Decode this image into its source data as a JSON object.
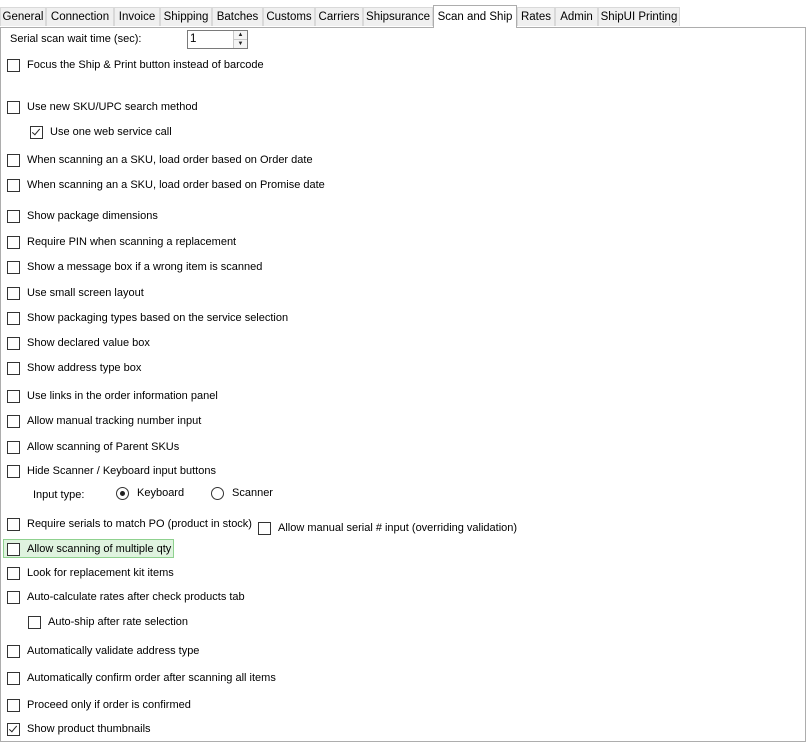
{
  "tabs": [
    {
      "label": "General"
    },
    {
      "label": "Connection"
    },
    {
      "label": "Invoice"
    },
    {
      "label": "Shipping"
    },
    {
      "label": "Batches"
    },
    {
      "label": "Customs"
    },
    {
      "label": "Carriers"
    },
    {
      "label": "Shipsurance"
    },
    {
      "label": "Scan and Ship",
      "active": true
    },
    {
      "label": "Rates"
    },
    {
      "label": "Admin"
    },
    {
      "label": "ShipUI Printing"
    }
  ],
  "serial_wait": {
    "label": "Serial scan wait time (sec):",
    "value": "1"
  },
  "options": {
    "focus_ship_print": {
      "label": "Focus the Ship & Print button instead of barcode",
      "checked": false
    },
    "new_sku_search": {
      "label": "Use new SKU/UPC search method",
      "checked": false
    },
    "one_web_service": {
      "label": "Use one web service call",
      "checked": true
    },
    "load_by_order_date": {
      "label": "When scanning an a SKU, load order based on Order date",
      "checked": false
    },
    "load_by_promise_date": {
      "label": "When scanning an a SKU, load order based on Promise date",
      "checked": false
    },
    "show_package_dimensions": {
      "label": "Show package dimensions",
      "checked": false
    },
    "require_pin": {
      "label": "Require PIN when scanning a replacement",
      "checked": false
    },
    "wrong_item_message": {
      "label": "Show a message box if a wrong item is scanned",
      "checked": false
    },
    "small_screen": {
      "label": "Use small screen layout",
      "checked": false
    },
    "packaging_types": {
      "label": "Show packaging types based on the service selection",
      "checked": false
    },
    "declared_value": {
      "label": "Show declared value box",
      "checked": false
    },
    "address_type_box": {
      "label": "Show address type box",
      "checked": false
    },
    "order_info_links": {
      "label": "Use links in the order information panel",
      "checked": false
    },
    "manual_tracking": {
      "label": "Allow manual tracking number input",
      "checked": false
    },
    "parent_skus": {
      "label": "Allow scanning of Parent SKUs",
      "checked": false
    },
    "hide_scanner_buttons": {
      "label": "Hide Scanner / Keyboard input buttons",
      "checked": false
    },
    "require_serials_po": {
      "label": "Require serials to match PO (product in stock)",
      "checked": false
    },
    "manual_serial_input": {
      "label": "Allow manual serial # input (overriding validation)",
      "checked": false
    },
    "multiple_qty": {
      "label": "Allow scanning of multiple qty",
      "checked": false
    },
    "replacement_kit": {
      "label": "Look for replacement kit items",
      "checked": false
    },
    "auto_calc_rates": {
      "label": "Auto-calculate rates after check products tab",
      "checked": false
    },
    "auto_ship": {
      "label": "Auto-ship after rate selection",
      "checked": false
    },
    "validate_address_type": {
      "label": "Automatically validate address type",
      "checked": false
    },
    "auto_confirm": {
      "label": "Automatically confirm order after scanning all items",
      "checked": false
    },
    "proceed_confirmed": {
      "label": "Proceed only if order is confirmed",
      "checked": false
    },
    "product_thumbnails": {
      "label": "Show product thumbnails",
      "checked": true
    }
  },
  "input_type": {
    "label": "Input type:",
    "keyboard": "Keyboard",
    "scanner": "Scanner",
    "selected": "Keyboard"
  },
  "icons": {
    "spin_up": "arrow-up-icon",
    "spin_down": "arrow-down-icon"
  }
}
